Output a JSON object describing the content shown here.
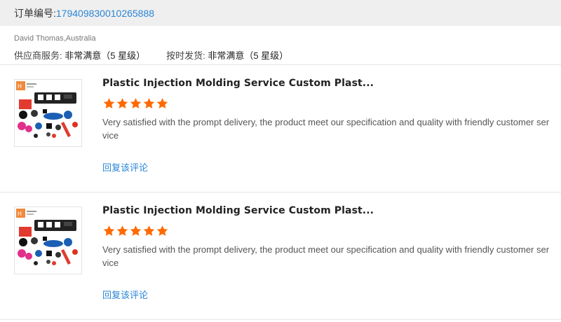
{
  "order": {
    "label": "订单编号:",
    "number": "179409830010265888"
  },
  "buyer": {
    "name": "David Thomas,Australia",
    "ratings": [
      {
        "label": "供应商服务:",
        "value": "非常满意（5 星级）"
      },
      {
        "label": "按时发货:",
        "value": "非常满意（5 星级）"
      }
    ]
  },
  "reviews": [
    {
      "title": "Plastic Injection Molding Service Custom Plast...",
      "stars": 5,
      "text": "Very satisfied with the prompt delivery, the product meet our specification and quality with friendly customer service",
      "reply": "回复该评论"
    },
    {
      "title": "Plastic Injection Molding Service Custom Plast...",
      "stars": 5,
      "text": "Very satisfied with the prompt delivery, the product meet our specification and quality with friendly customer service",
      "reply": "回复该评论"
    }
  ],
  "colors": {
    "link": "#2a86d6",
    "star": "#ff6a00",
    "header_bg": "#efefef"
  },
  "icons": {
    "star": "star-icon",
    "thumbnail": "product-thumbnail"
  }
}
